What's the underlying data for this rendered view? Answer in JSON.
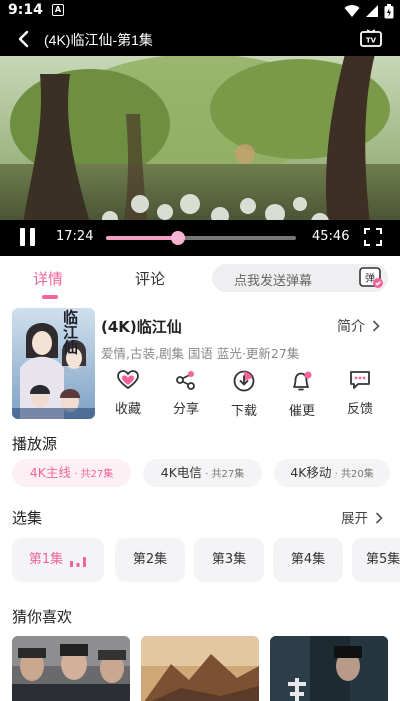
{
  "status_bar": {
    "time": "9:14",
    "notification_icon": "A"
  },
  "player": {
    "title": "(4K)临江仙-第1集",
    "current_time": "17:24",
    "duration": "45:46",
    "progress": 0.38
  },
  "tabs": {
    "detail": "详情",
    "comment": "评论",
    "danmu_placeholder": "点我发送弹幕",
    "danmu_button": "弹"
  },
  "show": {
    "title": "(4K)临江仙",
    "intro": "简介",
    "meta": "爱情,古装,剧集 国语 蓝光·更新27集",
    "poster_text": "临江仙"
  },
  "actions": [
    {
      "label": "收藏",
      "icon": "heart-icon"
    },
    {
      "label": "分享",
      "icon": "share-icon"
    },
    {
      "label": "下载",
      "icon": "download-icon"
    },
    {
      "label": "催更",
      "icon": "bell-icon"
    },
    {
      "label": "反馈",
      "icon": "feedback-icon"
    }
  ],
  "sources": {
    "title": "播放源",
    "items": [
      {
        "name": "4K主线",
        "count": " · 共27集"
      },
      {
        "name": "4K电信",
        "count": " · 共27集"
      },
      {
        "name": "4K移动",
        "count": " · 共20集"
      }
    ]
  },
  "episodes": {
    "title": "选集",
    "expand": "展开",
    "items": [
      "第1集",
      "第2集",
      "第3集",
      "第4集",
      "第5集"
    ]
  },
  "recommend": {
    "title": "猜你喜欢"
  },
  "colors": {
    "accent": "#f2649a",
    "progress": "#f4a0c6"
  }
}
